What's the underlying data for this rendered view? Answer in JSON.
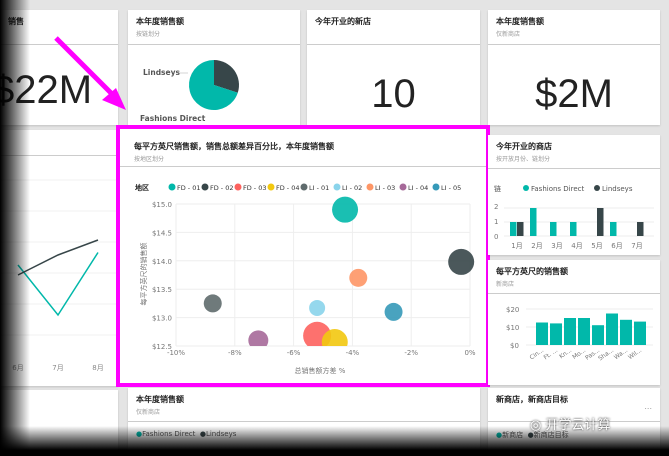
{
  "tiles": {
    "left_top": {
      "title": "销售",
      "value": "$22M"
    },
    "pie": {
      "title": "本年度销售额",
      "subtitle": "按链划分",
      "labels": [
        "Lindseys",
        "Fashions Direct"
      ],
      "values": [
        30,
        70
      ],
      "colors": [
        "#374649",
        "#01b8aa"
      ]
    },
    "new_stores": {
      "title": "今年开业的新店",
      "value": "10"
    },
    "new_sales": {
      "title": "本年度销售额",
      "subtitle": "仅新商店",
      "value": "$2M"
    },
    "line": {
      "xlabels": [
        "6月",
        "7月",
        "8月"
      ]
    },
    "opened": {
      "title": "今年开业的商店",
      "subtitle": "按开放月份、链划分",
      "legend_title": "链",
      "legend": [
        "Fashions Direct",
        "Lindseys"
      ],
      "yticks": [
        "2",
        "1",
        "0"
      ]
    },
    "sqft": {
      "title": "每平方英尺的销售额",
      "subtitle": "新商店",
      "yticks": [
        "$20",
        "$10",
        "$0"
      ]
    },
    "bottom_left": {
      "title": "本年度销售额",
      "subtitle": "仅新商店",
      "legend": [
        "Fashions Direct",
        "Lindseys"
      ]
    },
    "bottom_right": {
      "title": "新商店，新商店目标",
      "more": "...",
      "legend": [
        "新商店",
        "新商店目标"
      ]
    }
  },
  "watermark": "开学云计算",
  "chart_data": [
    {
      "type": "scatter",
      "title": "每平方英尺销售额，销售总额差异百分比，本年度销售额",
      "subtitle": "按地区划分",
      "legend_title": "地区",
      "xlabel": "总销售额方差 %",
      "ylabel": "每平方英尺的销售额",
      "xlim": [
        -10,
        0
      ],
      "ylim": [
        12.5,
        15
      ],
      "xticks": [
        "-10%",
        "-8%",
        "-6%",
        "-4%",
        "-2%",
        "0%"
      ],
      "yticks": [
        "$15.0",
        "$14.5",
        "$14.0",
        "$13.5",
        "$13.0",
        "$12.5"
      ],
      "series": [
        {
          "name": "FD - 01",
          "x": -4.25,
          "y": 14.9,
          "size": 13,
          "color": "#01b8aa"
        },
        {
          "name": "FD - 02",
          "x": -0.3,
          "y": 13.98,
          "size": 13,
          "color": "#374649"
        },
        {
          "name": "FD - 03",
          "x": -5.2,
          "y": 12.68,
          "size": 14,
          "color": "#fd625e"
        },
        {
          "name": "FD - 04",
          "x": -4.6,
          "y": 12.57,
          "size": 13,
          "color": "#f2c80f"
        },
        {
          "name": "LI - 01",
          "x": -8.75,
          "y": 13.25,
          "size": 9,
          "color": "#5f6b6d"
        },
        {
          "name": "LI - 02",
          "x": -5.2,
          "y": 13.17,
          "size": 8,
          "color": "#8ad4eb"
        },
        {
          "name": "LI - 03",
          "x": -3.8,
          "y": 13.7,
          "size": 9,
          "color": "#fe9666"
        },
        {
          "name": "LI - 04",
          "x": -7.2,
          "y": 12.6,
          "size": 10,
          "color": "#a66999"
        },
        {
          "name": "LI - 05",
          "x": -2.6,
          "y": 13.1,
          "size": 9,
          "color": "#3599b8"
        }
      ]
    },
    {
      "type": "bar",
      "categories": [
        "1月",
        "2月",
        "3月",
        "4月",
        "5月",
        "6月",
        "7月"
      ],
      "ylim": [
        0,
        2
      ],
      "series": [
        {
          "name": "Fashions Direct",
          "values": [
            1,
            2,
            1,
            1,
            0,
            1,
            0
          ],
          "color": "#01b8aa"
        },
        {
          "name": "Lindseys",
          "values": [
            1,
            0,
            0,
            0,
            2,
            0,
            1
          ],
          "color": "#374649"
        }
      ]
    },
    {
      "type": "bar",
      "categories": [
        "Cin...",
        "Ft. ...",
        "Kn...",
        "Mo...",
        "Pas...",
        "Sha...",
        "Wa...",
        "Wil..."
      ],
      "values": [
        12.5,
        12,
        15,
        15,
        11,
        17.5,
        14,
        13
      ],
      "ylim": [
        0,
        20
      ],
      "color": "#01b8aa"
    },
    {
      "type": "line",
      "categories": [
        "6月",
        "7月",
        "8月"
      ],
      "series": [
        {
          "name": "Fashions Direct",
          "values": [
            3,
            1,
            3.5
          ],
          "color": "#01b8aa"
        },
        {
          "name": "Lindseys",
          "values": [
            2.6,
            3.4,
            4
          ],
          "color": "#374649"
        }
      ]
    }
  ]
}
